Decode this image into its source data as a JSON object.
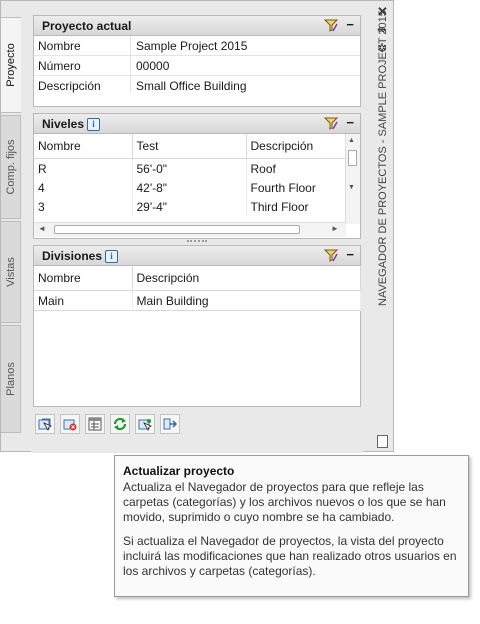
{
  "vertical_tabs": [
    "Proyecto",
    "Comp. fijos",
    "Vistas",
    "Planos"
  ],
  "window_title": "NAVEGADOR DE PROYECTOS - SAMPLE PROJECT 2015",
  "current_project": {
    "title": "Proyecto actual",
    "fields": [
      {
        "key": "Nombre",
        "value": "Sample Project 2015"
      },
      {
        "key": "Número",
        "value": "00000"
      },
      {
        "key": "Descripción",
        "value": "Small Office Building"
      }
    ]
  },
  "levels": {
    "title": "Niveles",
    "columns": [
      "Nombre",
      "Test",
      "Descripción"
    ],
    "rows": [
      [
        "R",
        "56'-0\"",
        "Roof"
      ],
      [
        "4",
        "42'-8\"",
        "Fourth Floor"
      ],
      [
        "3",
        "29'-4\"",
        "Third Floor"
      ]
    ]
  },
  "divisions": {
    "title": "Divisiones",
    "columns": [
      "Nombre",
      "Descripción"
    ],
    "rows": [
      [
        "Main",
        "Main Building"
      ]
    ]
  },
  "info_icon": "i",
  "toolbar_icons": [
    "add-project-icon",
    "close-project-icon",
    "project-properties-icon",
    "refresh-project-icon",
    "browse-project-icon",
    "sync-project-icon"
  ],
  "tooltip": {
    "title": "Actualizar proyecto",
    "paragraph1": "Actualiza el Navegador de proyectos para que refleje las carpetas (categorías) y los archivos nuevos o los que se han movido, suprimido o cuyo nombre se ha cambiado.",
    "paragraph2": "Si actualiza el Navegador de proyectos, la vista del proyecto incluirá las modificaciones que han realizado otros usuarios en los archivos y carpetas (categorías)."
  },
  "colors": {
    "refresh_green": "#1f9a2f",
    "accent_blue": "#2a6aa8"
  }
}
